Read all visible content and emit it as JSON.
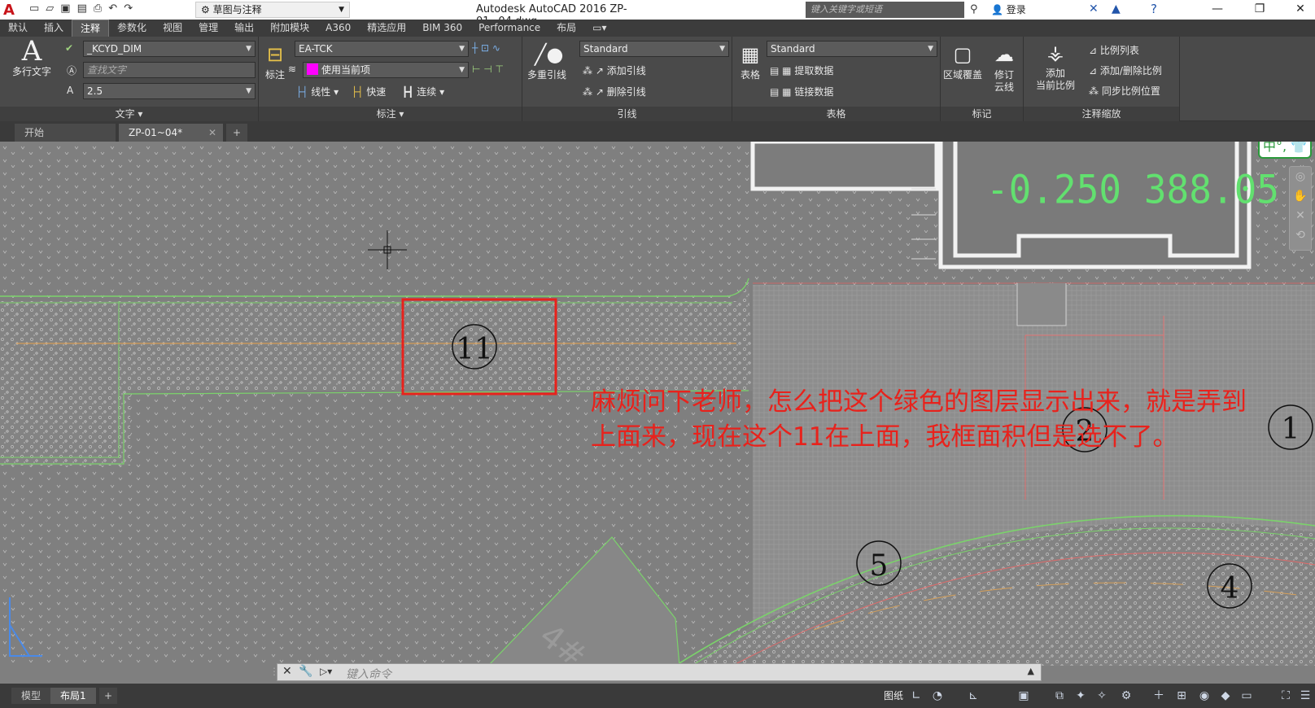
{
  "titlebar": {
    "app_icon": "A",
    "qat_icons": [
      "new-icon",
      "open-icon",
      "save-icon",
      "saveas-icon",
      "plot-icon",
      "undo-icon",
      "redo-icon"
    ],
    "workspace": "草图与注释",
    "title": "Autodesk AutoCAD 2016    ZP-01~04.dwg",
    "search_placeholder": "键入关键字或短语",
    "login": "登录",
    "min": "—",
    "max": "❐",
    "close": "✕"
  },
  "menu_tabs": [
    "默认",
    "插入",
    "注释",
    "参数化",
    "视图",
    "管理",
    "输出",
    "附加模块",
    "A360",
    "精选应用",
    "BIM 360",
    "Performance",
    "布局"
  ],
  "ribbon": {
    "text_panel": {
      "multiline_text": "多行文字",
      "style_value": "_KCYD_DIM",
      "find_placeholder": "查找文字",
      "height_value": "2.5",
      "label": "文字"
    },
    "dim_panel": {
      "dimension": "标注",
      "dimstyle_value": "EA-TCK",
      "layer_value": "使用当前项",
      "linear": "线性",
      "quick": "快速",
      "continue": "连续",
      "label": "标注"
    },
    "leader_panel": {
      "multileader": "多重引线",
      "style_value": "Standard",
      "add_leader": "添加引线",
      "remove_leader": "删除引线",
      "label": "引线"
    },
    "table_panel": {
      "table": "表格",
      "style_value": "Standard",
      "extract_data": "提取数据",
      "link_data": "链接数据",
      "label": "表格"
    },
    "markup_panel": {
      "wipeout": "区域覆盖",
      "revcloud_1": "修订",
      "revcloud_2": "云线",
      "label": "标记"
    },
    "scale_panel": {
      "add_scale_1": "添加",
      "add_scale_2": "当前比例",
      "scale_list": "比例列表",
      "add_delete_scale": "添加/删除比例",
      "sync_scale": "同步比例位置",
      "label": "注释缩放"
    }
  },
  "file_tabs": {
    "start": "开始",
    "active": "ZP-01~04*",
    "add": "+"
  },
  "drawing": {
    "elevation_text": "-0.250  388.05",
    "ime_badge": "中°,",
    "annotation_line1": "麻烦问下老师，怎么把这个绿色的图层显示出来，就是弄到",
    "annotation_line2": "上面来，现在这个11在上面，我框面积但是选不了。",
    "labels": {
      "n11": "11",
      "n2": "2",
      "n1": "1",
      "n5": "5",
      "n4": "4"
    },
    "watermark": "4#"
  },
  "command": {
    "placeholder": "键入命令"
  },
  "statusbar": {
    "model_tab": "模型",
    "layout_tab": "布局1",
    "add": "+",
    "paper": "图纸"
  },
  "colors": {
    "accent_green": "#7bd36b",
    "annotation_red": "#e8221c",
    "layer_magenta": "#ff00ff",
    "elevation_green": "#62e06f"
  }
}
